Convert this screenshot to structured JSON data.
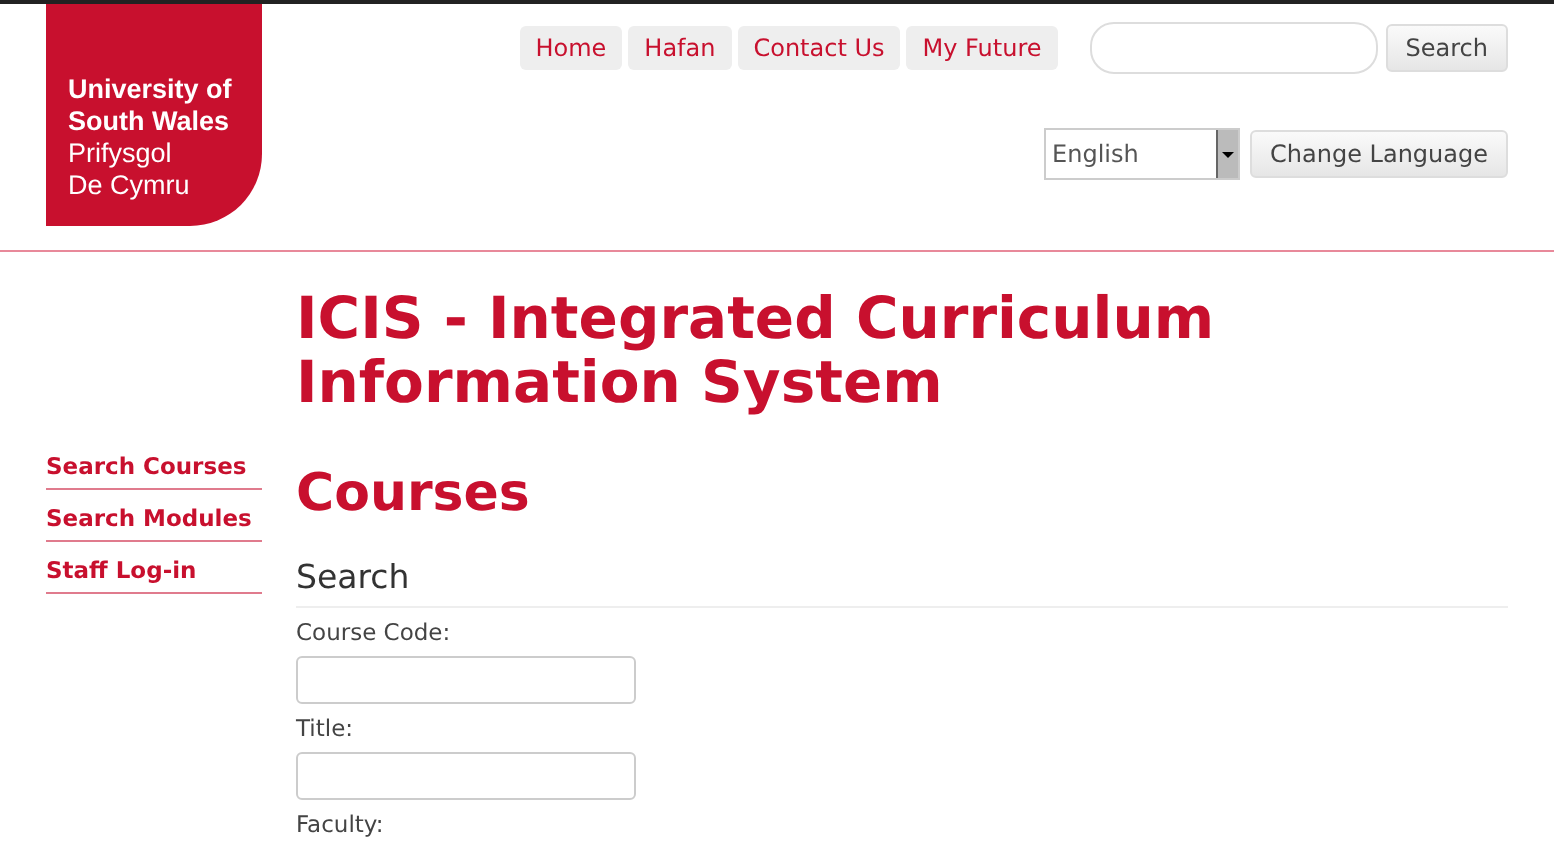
{
  "logo": {
    "lines": [
      "University of",
      "South Wales",
      "Prifysgol",
      "De Cymru"
    ]
  },
  "nav": [
    {
      "label": "Home"
    },
    {
      "label": "Hafan"
    },
    {
      "label": "Contact Us"
    },
    {
      "label": "My Future"
    }
  ],
  "site_search": {
    "button": "Search"
  },
  "language": {
    "value": "English",
    "button": "Change Language"
  },
  "sidebar": {
    "items": [
      {
        "label": "Search Courses"
      },
      {
        "label": "Search Modules"
      },
      {
        "label": "Staff Log-in"
      }
    ]
  },
  "page_title": "ICIS - Integrated Curriculum Information System",
  "heading": "Courses",
  "section": "Search",
  "fields": [
    {
      "label": "Course Code:",
      "kind": "text"
    },
    {
      "label": "Title:",
      "kind": "text"
    },
    {
      "label": "Faculty:",
      "kind": "label"
    }
  ]
}
